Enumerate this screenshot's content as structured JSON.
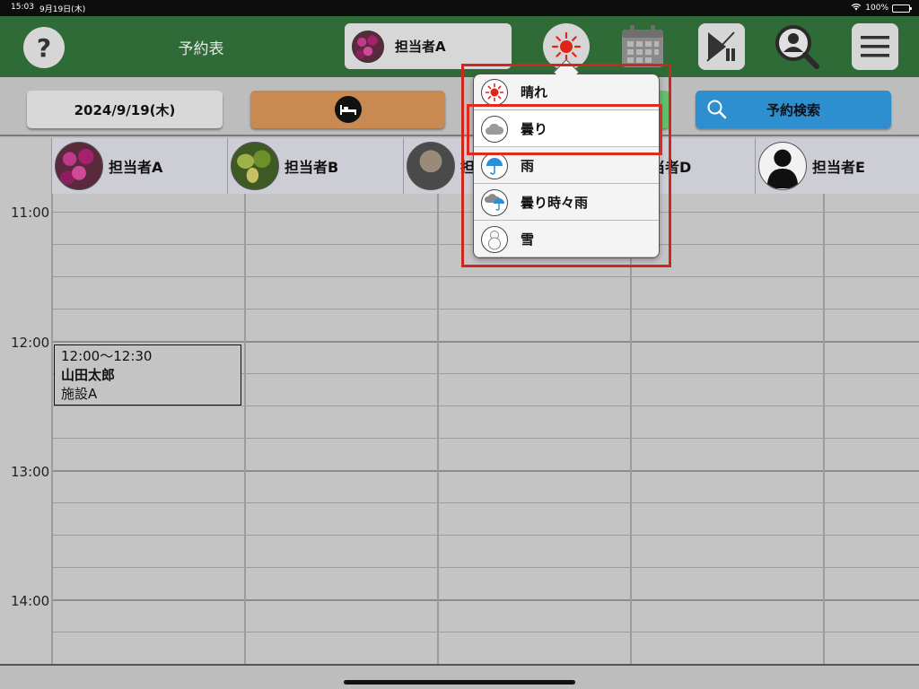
{
  "status_bar": {
    "time": "15:03",
    "date": "9月19日(木)",
    "battery": "100%"
  },
  "header": {
    "help_label": "?",
    "title": "予約表",
    "staff_selector": "担当者A",
    "icons": [
      "help-icon",
      "sun-icon",
      "calendar-icon",
      "play-pause-icon",
      "user-search-icon",
      "menu-icon"
    ]
  },
  "toolbar": {
    "date": "2024/9/19(木)",
    "facility_icon": "bed-icon",
    "reservation_search": "予約検索"
  },
  "weather_menu": {
    "items": [
      {
        "label": "晴れ",
        "icon": "sun-icon"
      },
      {
        "label": "曇り",
        "icon": "cloud-icon"
      },
      {
        "label": "雨",
        "icon": "umbrella-icon"
      },
      {
        "label": "曇り時々雨",
        "icon": "cloud-rain-icon"
      },
      {
        "label": "雪",
        "icon": "snowman-icon"
      }
    ],
    "selected": "曇り"
  },
  "schedule": {
    "staff": [
      "担当者A",
      "担当者B",
      "担当者C",
      "担当者D",
      "担当者E"
    ],
    "times": [
      "11:00",
      "12:00",
      "13:00",
      "14:00"
    ],
    "appointments": [
      {
        "time": "12:00～12:30",
        "client": "山田太郎",
        "facility": "施設A"
      }
    ]
  },
  "colors": {
    "header_bg": "#2e6b36",
    "facility_button": "#c98a52",
    "search_button": "#2e8fd0",
    "highlight": "#d0271d"
  }
}
